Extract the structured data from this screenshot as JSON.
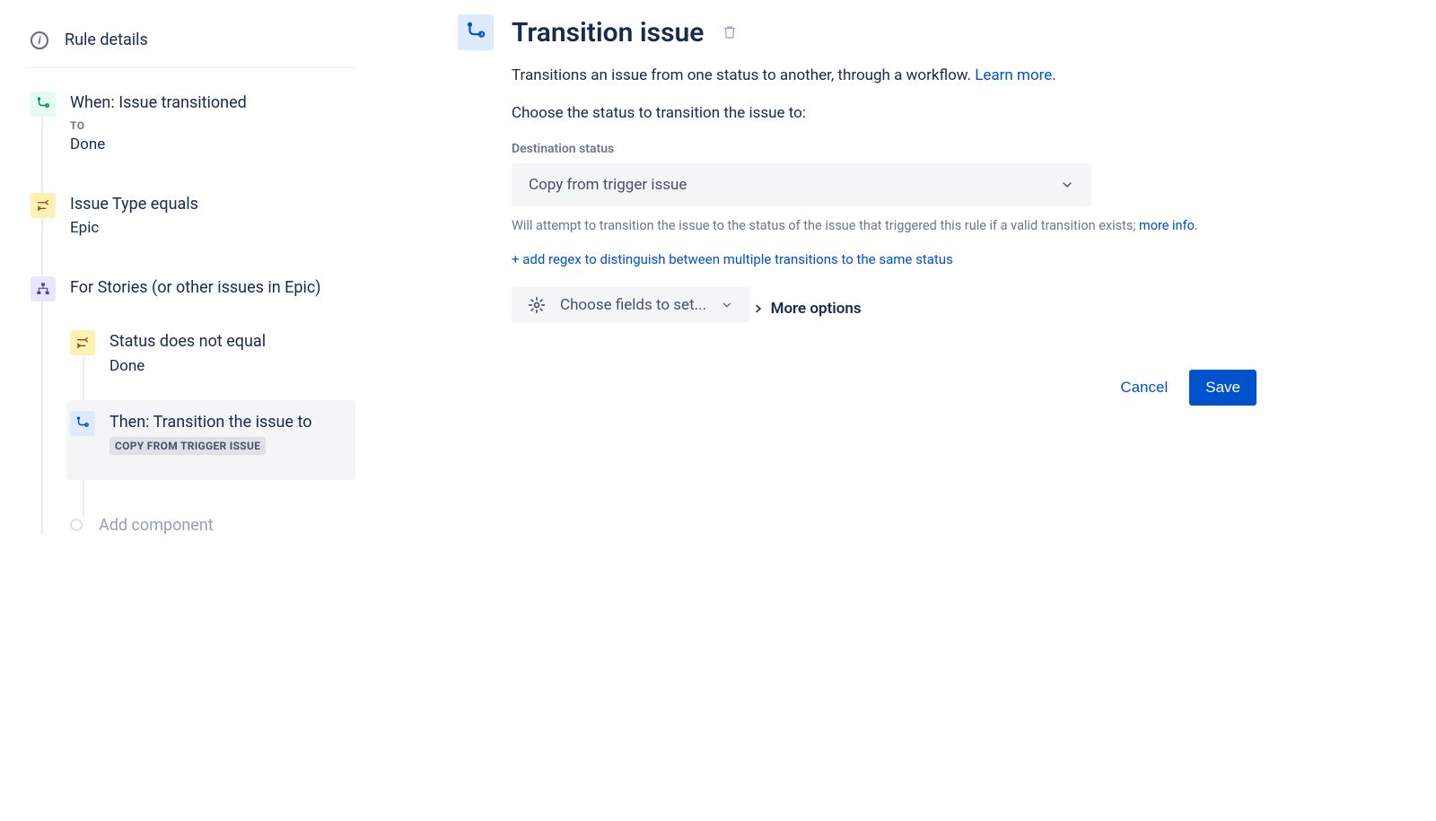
{
  "sidebar": {
    "ruleDetails": "Rule details",
    "steps": [
      {
        "title": "When: Issue transitioned",
        "subLabel": "TO",
        "value": "Done",
        "iconType": "green",
        "icon": "transition"
      },
      {
        "title": "Issue Type equals",
        "value": "Epic",
        "iconType": "yellow",
        "icon": "condition"
      },
      {
        "title": "For Stories (or other issues in Epic)",
        "iconType": "purple",
        "icon": "branch"
      }
    ],
    "nestedSteps": [
      {
        "title": "Status does not equal",
        "value": "Done",
        "iconType": "yellow",
        "icon": "condition"
      },
      {
        "title": "Then: Transition the issue to",
        "badge": "COPY FROM TRIGGER ISSUE",
        "iconType": "blue",
        "icon": "transition",
        "selected": true
      }
    ],
    "addComponent": "Add component"
  },
  "main": {
    "title": "Transition issue",
    "description": "Transitions an issue from one status to another, through a workflow. ",
    "learnMore": "Learn more.",
    "chooseLabel": "Choose the status to transition the issue to:",
    "destLabel": "Destination status",
    "destValue": "Copy from trigger issue",
    "helperText": "Will attempt to transition the issue to the status of the issue that triggered this rule if a valid transition exists; ",
    "moreInfo": "more info.",
    "addRegex": "+ add regex to distinguish between multiple transitions to the same status",
    "chooseFields": "Choose fields to set...",
    "moreOptions": "More options",
    "cancel": "Cancel",
    "save": "Save"
  }
}
